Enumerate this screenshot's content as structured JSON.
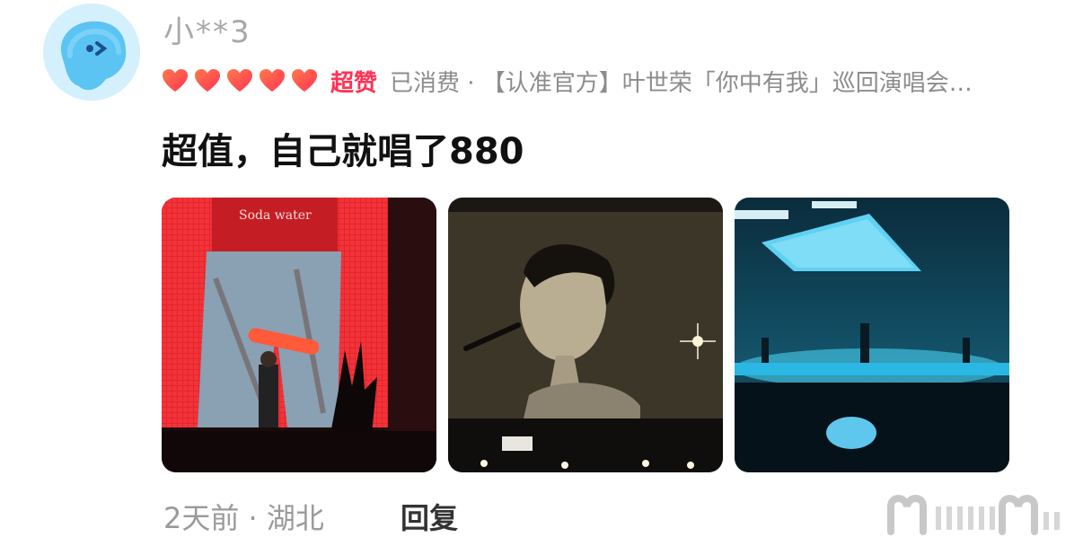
{
  "comment": {
    "avatar_icon": "blue-blob-face-icon",
    "username": "小**3",
    "rating": {
      "value": 5,
      "max": 5,
      "icon": "heart-icon",
      "color": "#ff3355",
      "label": "超赞"
    },
    "purchase_info": "已消费 · 【认准官方】叶世荣「你中有我」巡回演唱会…",
    "text": "超值，自己就唱了880",
    "photos": [
      {
        "name": "concert-photo-red-screen",
        "screen_text": "Soda water"
      },
      {
        "name": "concert-photo-singer-monochrome"
      },
      {
        "name": "concert-photo-blue-stage"
      }
    ],
    "time_location": "2天前 · 湖北",
    "reply_label": "回复"
  },
  "accent_colors": {
    "heart": "#ff3355",
    "muted": "#9a9a9a"
  }
}
